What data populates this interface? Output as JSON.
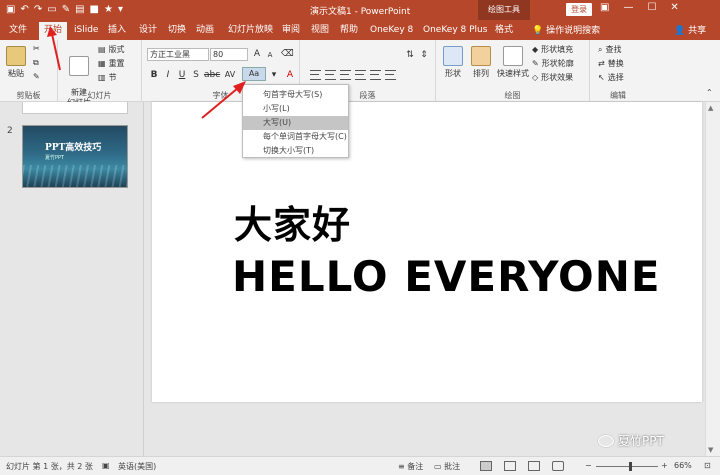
{
  "titlebar": {
    "doc_title": "演示文稿1 - PowerPoint",
    "context_tab": "绘图工具",
    "login": "登录",
    "qat_icons": [
      "save-icon",
      "undo-icon",
      "redo-icon",
      "shape-icon",
      "format-painter-icon",
      "picture-icon",
      "star-icon",
      "more-icon"
    ]
  },
  "tabs": [
    {
      "label": "文件",
      "name": "tab-file"
    },
    {
      "label": "开始",
      "name": "tab-home"
    },
    {
      "label": "iSlide",
      "name": "tab-islide"
    },
    {
      "label": "插入",
      "name": "tab-insert"
    },
    {
      "label": "设计",
      "name": "tab-design"
    },
    {
      "label": "切换",
      "name": "tab-transitions"
    },
    {
      "label": "动画",
      "name": "tab-animations"
    },
    {
      "label": "幻灯片放映",
      "name": "tab-slideshow"
    },
    {
      "label": "审阅",
      "name": "tab-review"
    },
    {
      "label": "视图",
      "name": "tab-view"
    },
    {
      "label": "帮助",
      "name": "tab-help"
    },
    {
      "label": "OneKey 8",
      "name": "tab-onekey8"
    },
    {
      "label": "OneKey 8 Plus",
      "name": "tab-onekey8plus"
    },
    {
      "label": "格式",
      "name": "tab-format"
    }
  ],
  "tell_me": "操作说明搜索",
  "share": "共享",
  "ribbon": {
    "clipboard": {
      "paste": "粘贴",
      "label": "剪贴板"
    },
    "slides": {
      "new_slide": "新建\n幻灯片",
      "layout": "版式",
      "reset": "重置",
      "section": "节",
      "label": "幻灯片"
    },
    "font": {
      "font_name": "方正工业黑",
      "font_size": "80",
      "case_button": "Aa",
      "label": "字体"
    },
    "paragraph": {
      "label": "段落"
    },
    "drawing": {
      "shapes": "形状",
      "arrange": "排列",
      "quick_styles": "快速样式",
      "fill": "形状填充",
      "outline": "形状轮廓",
      "effects": "形状效果",
      "label": "绘图"
    },
    "editing": {
      "find": "查找",
      "replace": "替换",
      "select": "选择",
      "label": "编辑"
    }
  },
  "case_menu": {
    "items": [
      "句首字母大写(S)",
      "小写(L)",
      "大写(U)",
      "每个单词首字母大写(C)",
      "切换大小写(T)"
    ],
    "highlighted_index": 2
  },
  "thumbnails": {
    "slide2_number": "2",
    "slide2_title": "PPT高效技巧",
    "slide2_subtitle": "夏竹PPT"
  },
  "slide": {
    "line1": "大家好",
    "line2": "HELLO EVERYONE"
  },
  "watermark": "夏竹PPT",
  "statusbar": {
    "slide_info": "幻灯片 第 1 张，共 2 张",
    "language": "英语(美国)",
    "notes": "备注",
    "comments": "批注",
    "zoom": "66%",
    "zoom_fraction": 0.55
  },
  "colors": {
    "accent": "#b7472a",
    "arrow": "#e02020"
  }
}
